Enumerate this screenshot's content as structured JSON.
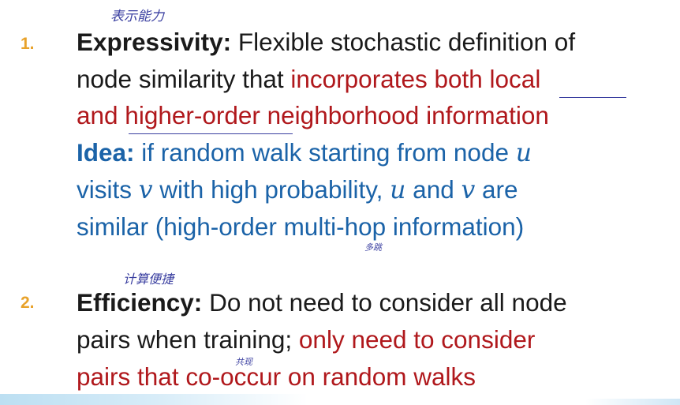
{
  "annotations": {
    "top": "表示能力",
    "multi_hop": "多跳",
    "efficiency": "计算便捷",
    "co_occur": "共现"
  },
  "item1": {
    "number": "1.",
    "title": "Expressivity:",
    "line1_rest": " Flexible stochastic definition of",
    "line2_a": "node similarity that ",
    "line2_b": "incorporates both local",
    "line3": "and higher-order neighborhood information",
    "idea_label": "Idea:",
    "idea_line1": " if random walk starting from node ",
    "var_u": "u",
    "var_v": "v",
    "idea_line2_a": "visits ",
    "idea_line2_b": " with high probability, ",
    "idea_line2_c": " and ",
    "idea_line2_d": " are",
    "idea_line3": "similar (high-order multi-hop information)"
  },
  "item2": {
    "number": "2.",
    "title": "Efficiency:",
    "line1_rest": " Do not need to consider all node",
    "line2_a": "pairs when training; ",
    "line2_b": "only need to consider",
    "line3": "pairs that co-occur on random walks"
  }
}
